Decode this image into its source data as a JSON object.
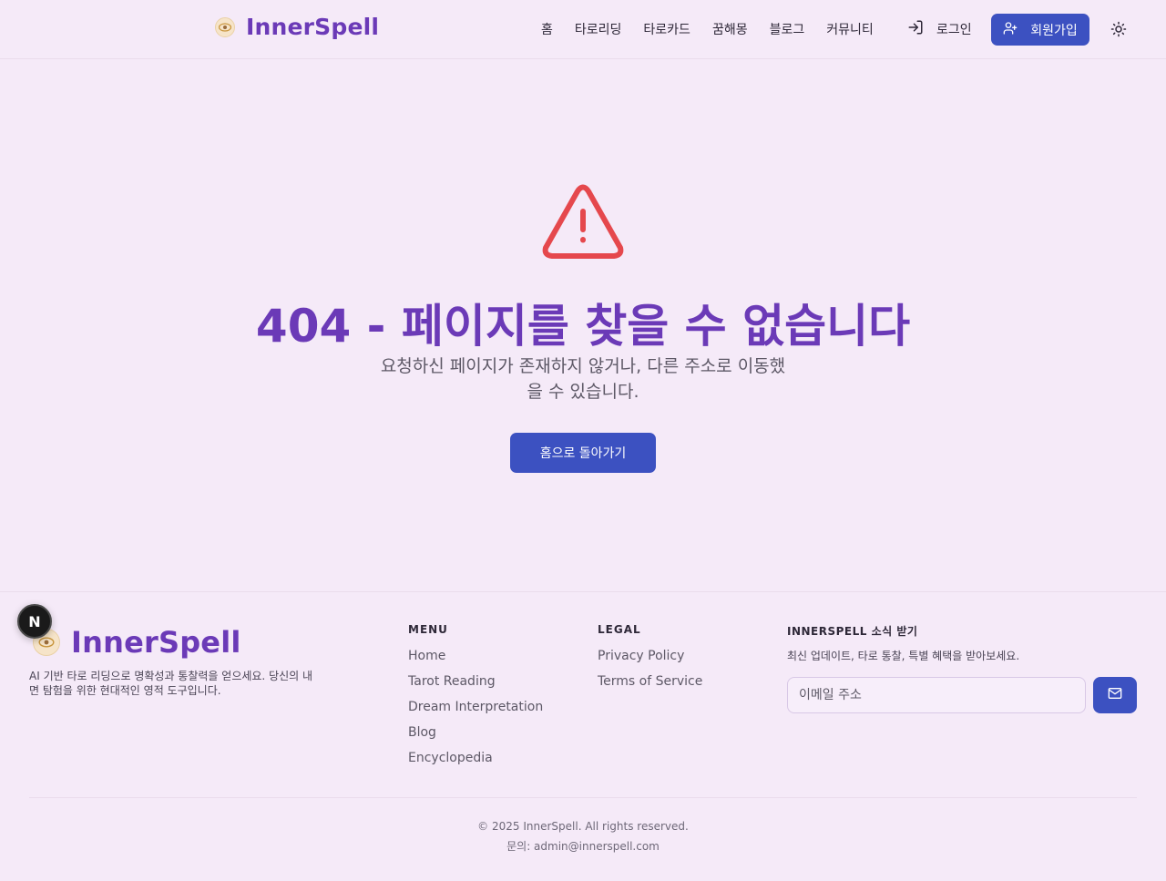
{
  "header": {
    "brand_name": "InnerSpell",
    "nav": [
      {
        "label": "홈"
      },
      {
        "label": "타로리딩"
      },
      {
        "label": "타로카드"
      },
      {
        "label": "꿈해몽"
      },
      {
        "label": "블로그"
      },
      {
        "label": "커뮤니티"
      }
    ],
    "login_label": "로그인",
    "signup_label": "회원가입",
    "icons": {
      "login": "log-in-icon",
      "signup": "user-plus-icon",
      "theme": "sun-icon"
    }
  },
  "main": {
    "icon": "alert-triangle-icon",
    "title": "404 - 페이지를 찾을 수 없습니다",
    "description": "요청하신 페이지가 존재하지 않거나, 다른 주소로 이동했을 수 있습니다.",
    "home_button_label": "홈으로 돌아가기"
  },
  "footer": {
    "brand_name": "InnerSpell",
    "description": "AI 기반 타로 리딩으로 명확성과 통찰력을 얻으세요. 당신의 내면 탐험을 위한 현대적인 영적 도구입니다.",
    "menu_title": "MENU",
    "menu_links": [
      {
        "label": "Home"
      },
      {
        "label": "Tarot Reading"
      },
      {
        "label": "Dream Interpretation"
      },
      {
        "label": "Blog"
      },
      {
        "label": "Encyclopedia"
      }
    ],
    "legal_title": "LEGAL",
    "legal_links": [
      {
        "label": "Privacy Policy"
      },
      {
        "label": "Terms of Service"
      }
    ],
    "newsletter_title": "INNERSPELL 소식 받기",
    "newsletter_desc": "최신 업데이트, 타로 통찰, 특별 혜택을 받아보세요.",
    "email_placeholder": "이메일 주소",
    "copyright": "© 2025 InnerSpell. All rights reserved.",
    "contact": "문의: admin@innerspell.com"
  },
  "next_badge": "N",
  "colors": {
    "brand": "#6b3ab7",
    "primary_button": "#3c51c1",
    "warning": "#e5484d",
    "background": "#f5eaf8"
  }
}
